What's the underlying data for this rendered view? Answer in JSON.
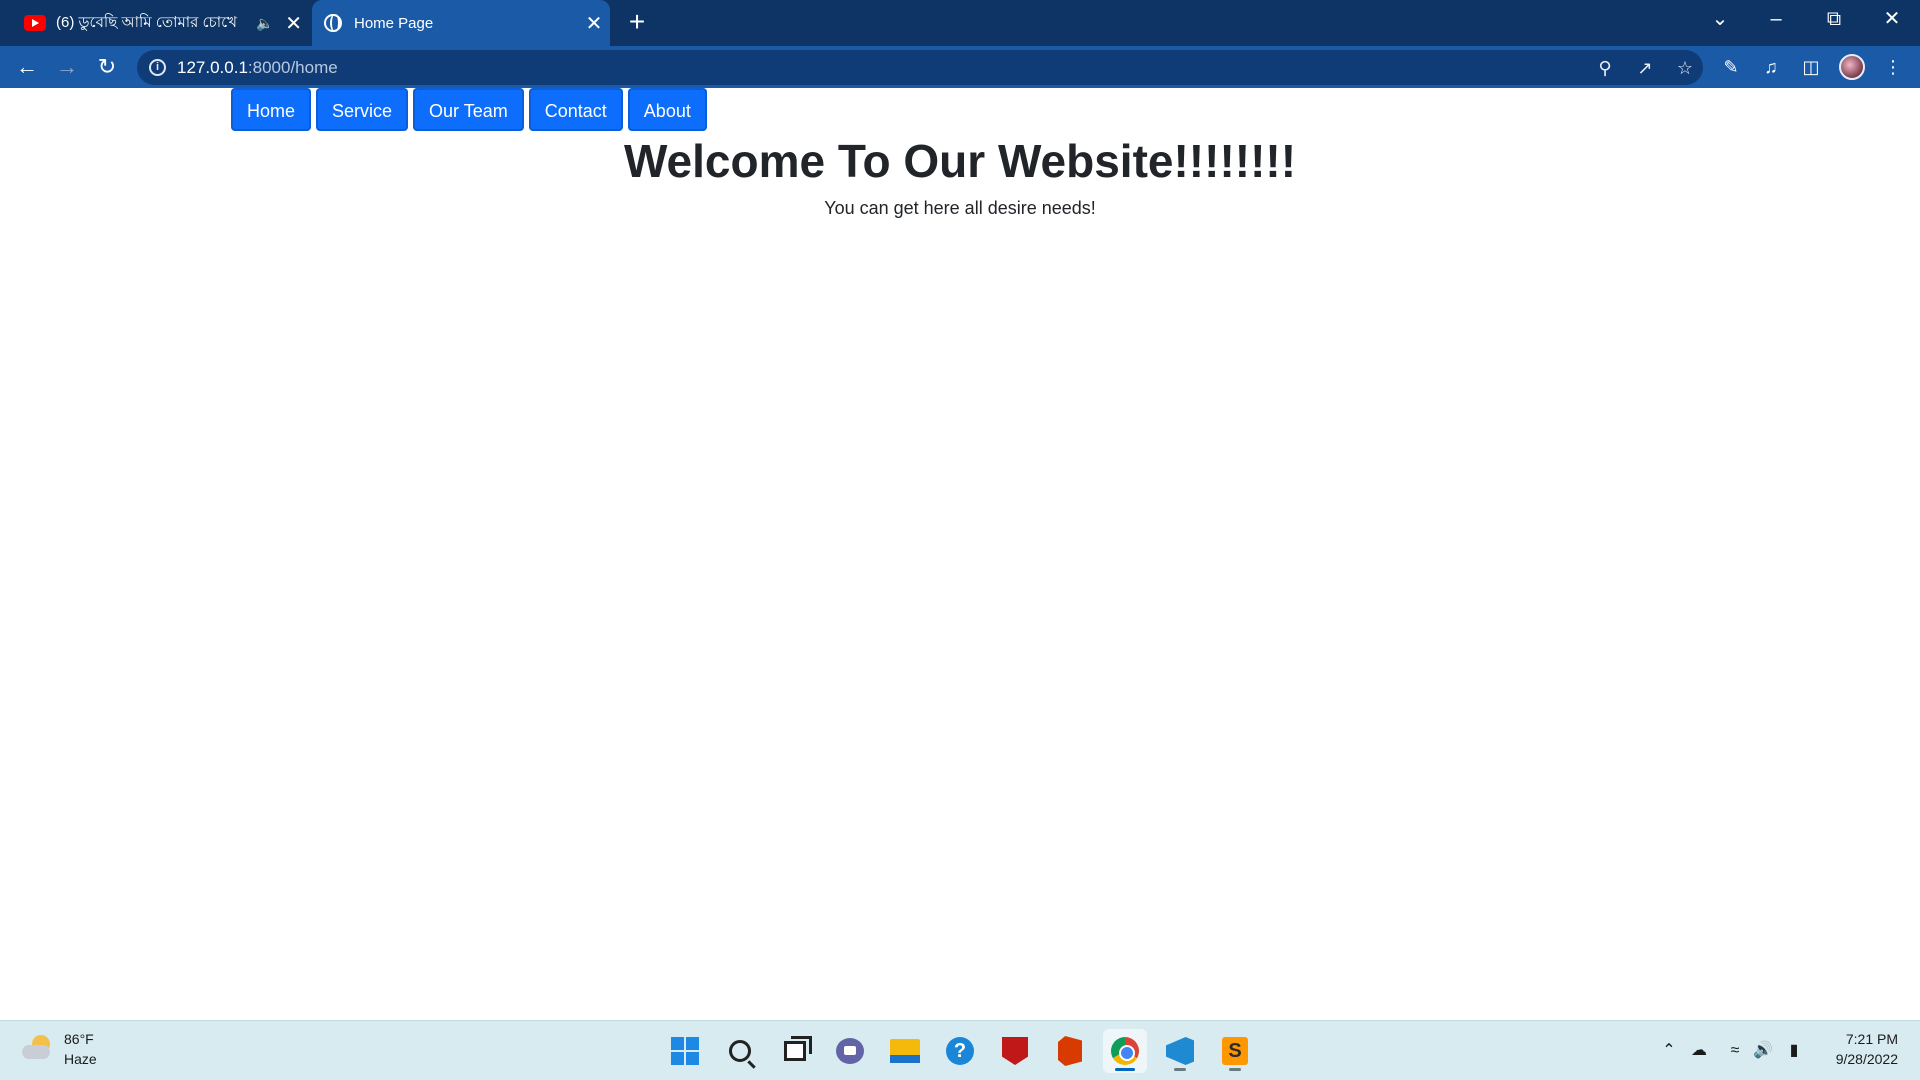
{
  "browser": {
    "tabs": [
      {
        "title": "(6) ডুবেছি আমি তোমার চোখে",
        "icon": "youtube-icon",
        "muted_icon": "speaker-icon"
      },
      {
        "title": "Home Page",
        "icon": "globe-icon",
        "active": true
      }
    ],
    "url_host": "127.0.0.1",
    "url_path": ":8000/home"
  },
  "page": {
    "nav": [
      "Home",
      "Service",
      "Our Team",
      "Contact",
      "About"
    ],
    "heading": "Welcome To Our Website!!!!!!!!",
    "subheading": "You can get here all desire needs!"
  },
  "taskbar": {
    "weather": {
      "temp": "86°F",
      "condition": "Haze"
    },
    "apps": [
      "start",
      "search",
      "task-view",
      "chat",
      "file-explorer",
      "get-help",
      "mcafee",
      "office",
      "chrome",
      "vscode",
      "sublime-text"
    ],
    "active_app": "chrome",
    "clock": {
      "time": "7:21 PM",
      "date": "9/28/2022"
    }
  },
  "colors": {
    "tabstrip": "#0d3464",
    "toolbar": "#1b5aa6",
    "nav_button": "#0d6efd",
    "taskbar": "#d8ebf1"
  }
}
